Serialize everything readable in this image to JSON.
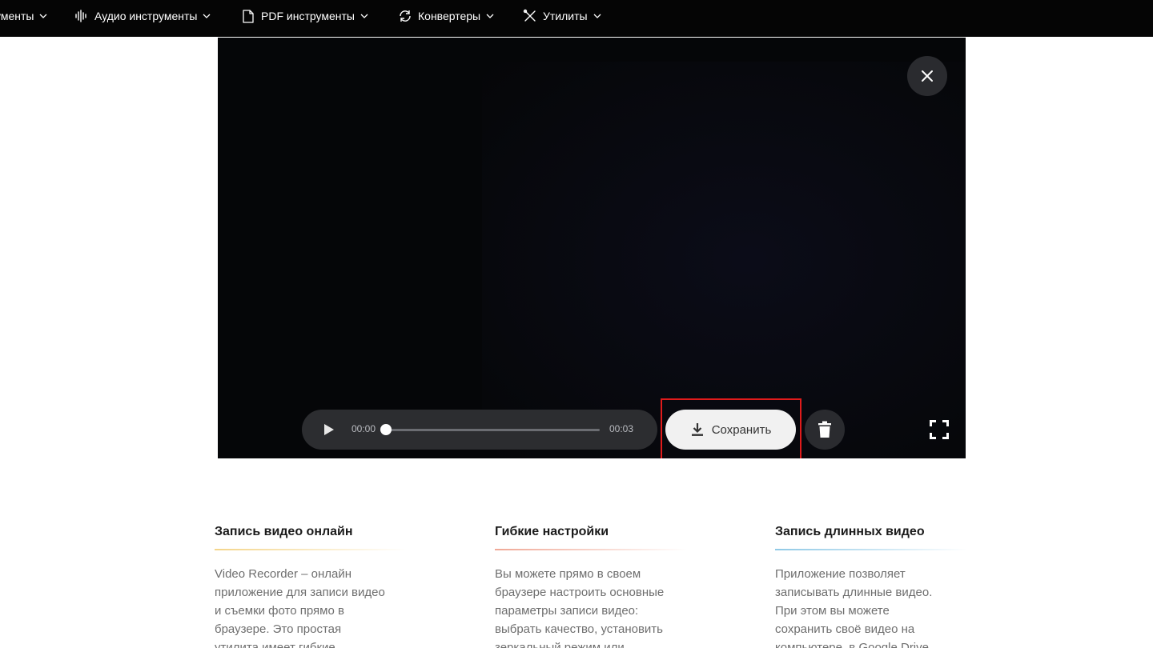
{
  "nav": {
    "items": [
      {
        "label": "ументы",
        "icon": "video-icon"
      },
      {
        "label": "Аудио инструменты",
        "icon": "audio-wave-icon"
      },
      {
        "label": "PDF инструменты",
        "icon": "document-icon"
      },
      {
        "label": "Конвертеры",
        "icon": "convert-icon"
      },
      {
        "label": "Утилиты",
        "icon": "tools-icon"
      }
    ]
  },
  "player": {
    "current_time": "00:00",
    "duration": "00:03",
    "progress": 0.0,
    "save_label": "Сохранить"
  },
  "colors": {
    "highlight": "#e01b1b",
    "nav_bg": "#050505",
    "accent_lines": [
      "#f4d58a",
      "#f0a896",
      "#8fc9e6"
    ]
  },
  "features": [
    {
      "title": "Запись видео онлайн",
      "lines": [
        "Video Recorder – онлайн",
        "приложение для записи видео",
        "и съемки фото прямо в",
        "браузере. Это простая",
        "утилита имеет гибкие"
      ]
    },
    {
      "title": "Гибкие настройки",
      "lines": [
        "Вы можете прямо в своем",
        "браузере настроить основные",
        "параметры записи видео:",
        "выбрать качество, установить",
        "зеркальный режим или"
      ]
    },
    {
      "title": "Запись длинных видео",
      "lines": [
        "Приложение позволяет",
        "записывать длинные видео.",
        "При этом вы можете",
        "сохранить своё видео на",
        "компьютере, в Google Drive"
      ]
    }
  ]
}
